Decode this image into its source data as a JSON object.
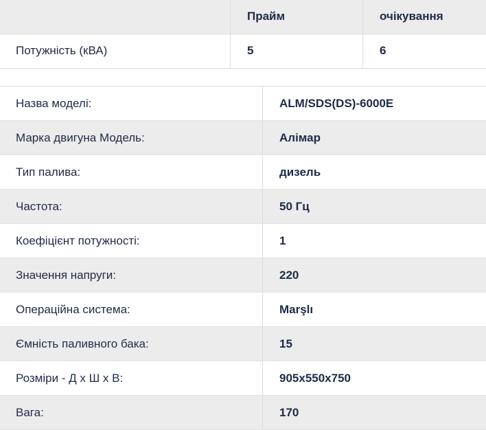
{
  "power": {
    "header": {
      "empty": "",
      "prime": "Прайм",
      "standby": "очікування"
    },
    "row": {
      "label": "Потужність (кВА)",
      "prime": "5",
      "standby": "6"
    }
  },
  "specs": [
    {
      "label": "Назва моделі:",
      "value": "ALM/SDS(DS)-6000E"
    },
    {
      "label": "Марка двигуна Модель:",
      "value": "Алімар"
    },
    {
      "label": "Тип палива:",
      "value": "дизель"
    },
    {
      "label": "Частота:",
      "value": "50 Гц"
    },
    {
      "label": "Коефіцієнт потужності:",
      "value": "1"
    },
    {
      "label": "Значення напруги:",
      "value": "220"
    },
    {
      "label": "Операційна система:",
      "value": "Marşlı"
    },
    {
      "label": "Ємність паливного бака:",
      "value": "15"
    },
    {
      "label": "Розміри - Д х Ш х В:",
      "value": "905x550x750"
    },
    {
      "label": "Вага:",
      "value": "170"
    }
  ]
}
